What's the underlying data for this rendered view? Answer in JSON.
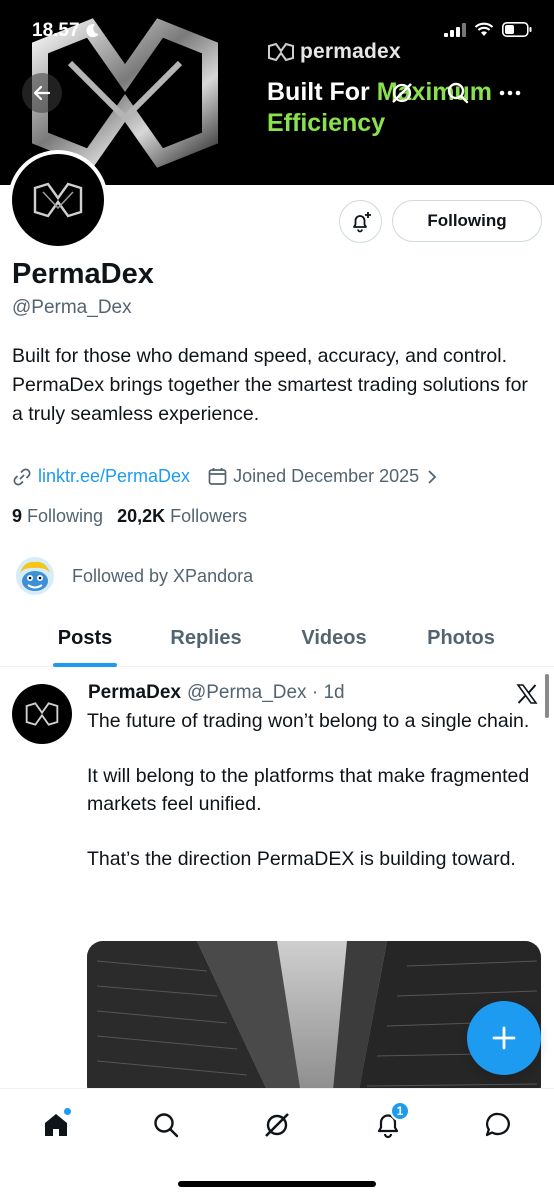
{
  "status_bar": {
    "time": "18.57"
  },
  "banner": {
    "brand": "permadex",
    "tagline_part1": "Built For ",
    "tagline_accent": "Maximum",
    "tagline_line2": "Efficiency"
  },
  "profile": {
    "display_name": "PermaDex",
    "handle": "@Perma_Dex",
    "bio_line1": "Built for those who demand speed, accuracy, and control.",
    "bio_line2": "PermaDex brings together the smartest trading solutions for a truly seamless experience.",
    "link": "linktr.ee/PermaDex",
    "joined": "Joined December 2025",
    "following_count": "9",
    "following_label": "Following",
    "followers_count": "20,2K",
    "followers_label": "Followers",
    "followed_by": "Followed by XPandora",
    "follow_button_label": "Following"
  },
  "tabs": [
    {
      "label": "Posts",
      "active": true
    },
    {
      "label": "Replies",
      "active": false
    },
    {
      "label": "Videos",
      "active": false
    },
    {
      "label": "Photos",
      "active": false
    }
  ],
  "post": {
    "author": "PermaDex",
    "handle_time": "@Perma_Dex · 1d",
    "para1": "The future of trading won’t belong to a single chain.",
    "para2": "It will belong to the platforms that make fragmented markets feel unified.",
    "para3": "That’s the direction PermaDEX is building toward."
  },
  "bottom_nav": {
    "notifications_badge": "1"
  },
  "colors": {
    "accent_blue": "#1d9bf0",
    "banner_green": "#8be04e",
    "muted_text": "#536471"
  }
}
